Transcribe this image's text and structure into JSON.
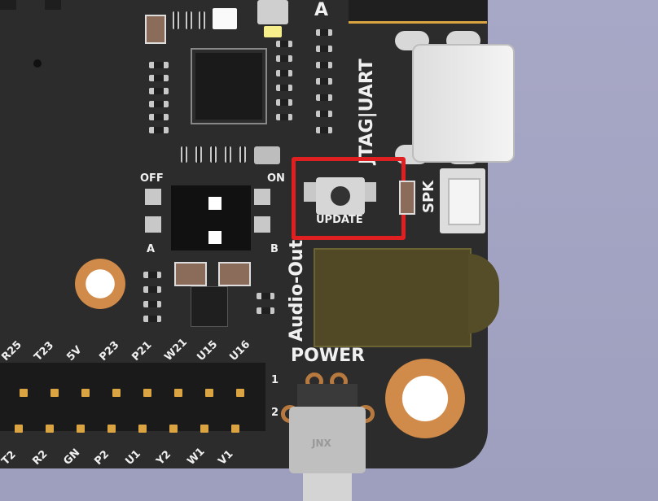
{
  "silkscreen": {
    "top_left_letter": "A",
    "port_label": "JTAG|UART",
    "switch_off": "OFF",
    "switch_on": "ON",
    "switch_a": "A",
    "switch_b": "B",
    "update": "UPDATE",
    "spk": "SPK",
    "audio_out": "Audio-Out",
    "power": "POWER",
    "header_pin_1": "1",
    "header_pin_2": "2",
    "header_top_labels": [
      "R25",
      "T23",
      "5V",
      "P23",
      "P21",
      "W21",
      "U15",
      "U16"
    ],
    "header_bottom_labels": [
      "T2",
      "R2",
      "GN",
      "P2",
      "U1",
      "Y2",
      "W1",
      "V1"
    ],
    "connector_mark": "JNX"
  },
  "highlight": {
    "color": "#e02020"
  },
  "colors": {
    "board": "#2c2c2c",
    "pad": "#d08a4a",
    "gold": "#d9a441"
  }
}
